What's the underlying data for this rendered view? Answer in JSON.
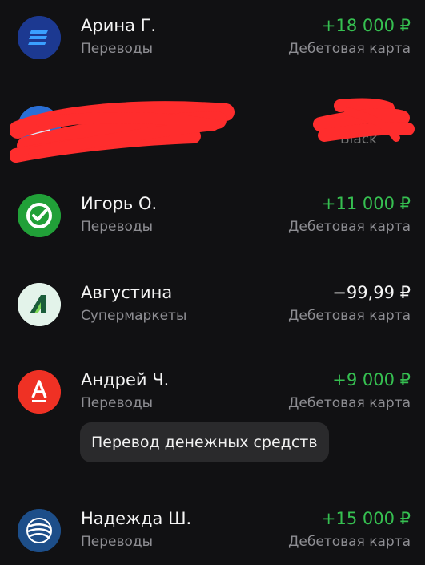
{
  "transactions": [
    {
      "name": "Арина Г.",
      "category": "Переводы",
      "amount": "+18 000 ₽",
      "account": "Дебетовая карта",
      "type": "income",
      "logo": "bank-logo-stripes-icon",
      "logo_bg": "#1f3a8f"
    },
    {
      "name": "",
      "category": "",
      "amount": "",
      "account": "Black",
      "type": "income",
      "logo": "redacted-bank-logo-icon",
      "logo_bg": "#2a6fd6",
      "redacted": true
    },
    {
      "name": "Игорь О.",
      "category": "Переводы",
      "amount": "+11 000 ₽",
      "account": "Дебетовая карта",
      "type": "income",
      "logo": "sber-check-icon",
      "logo_bg": "#21a038"
    },
    {
      "name": "Августина",
      "category": "Супермаркеты",
      "amount": "−99,99 ₽",
      "account": "Дебетовая карта",
      "type": "expense",
      "logo": "supermarket-a-icon",
      "logo_bg": "#e6f4ec"
    },
    {
      "name": "Андрей Ч.",
      "category": "Переводы",
      "amount": "+9 000 ₽",
      "account": "Дебетовая карта",
      "type": "income",
      "logo": "alfa-a-icon",
      "logo_bg": "#ef3124"
    },
    {
      "name": "Надежда Ш.",
      "category": "Переводы",
      "amount": "+15 000 ₽",
      "account": "Дебетовая карта",
      "type": "income",
      "logo": "globe-bank-icon",
      "logo_bg": "#1d4e89"
    }
  ],
  "transfer_message": "Перевод денежных средств",
  "colors": {
    "background": "#111113",
    "income": "#36c051",
    "secondary_text": "#8e8e93",
    "redaction": "#ff2d2d"
  }
}
